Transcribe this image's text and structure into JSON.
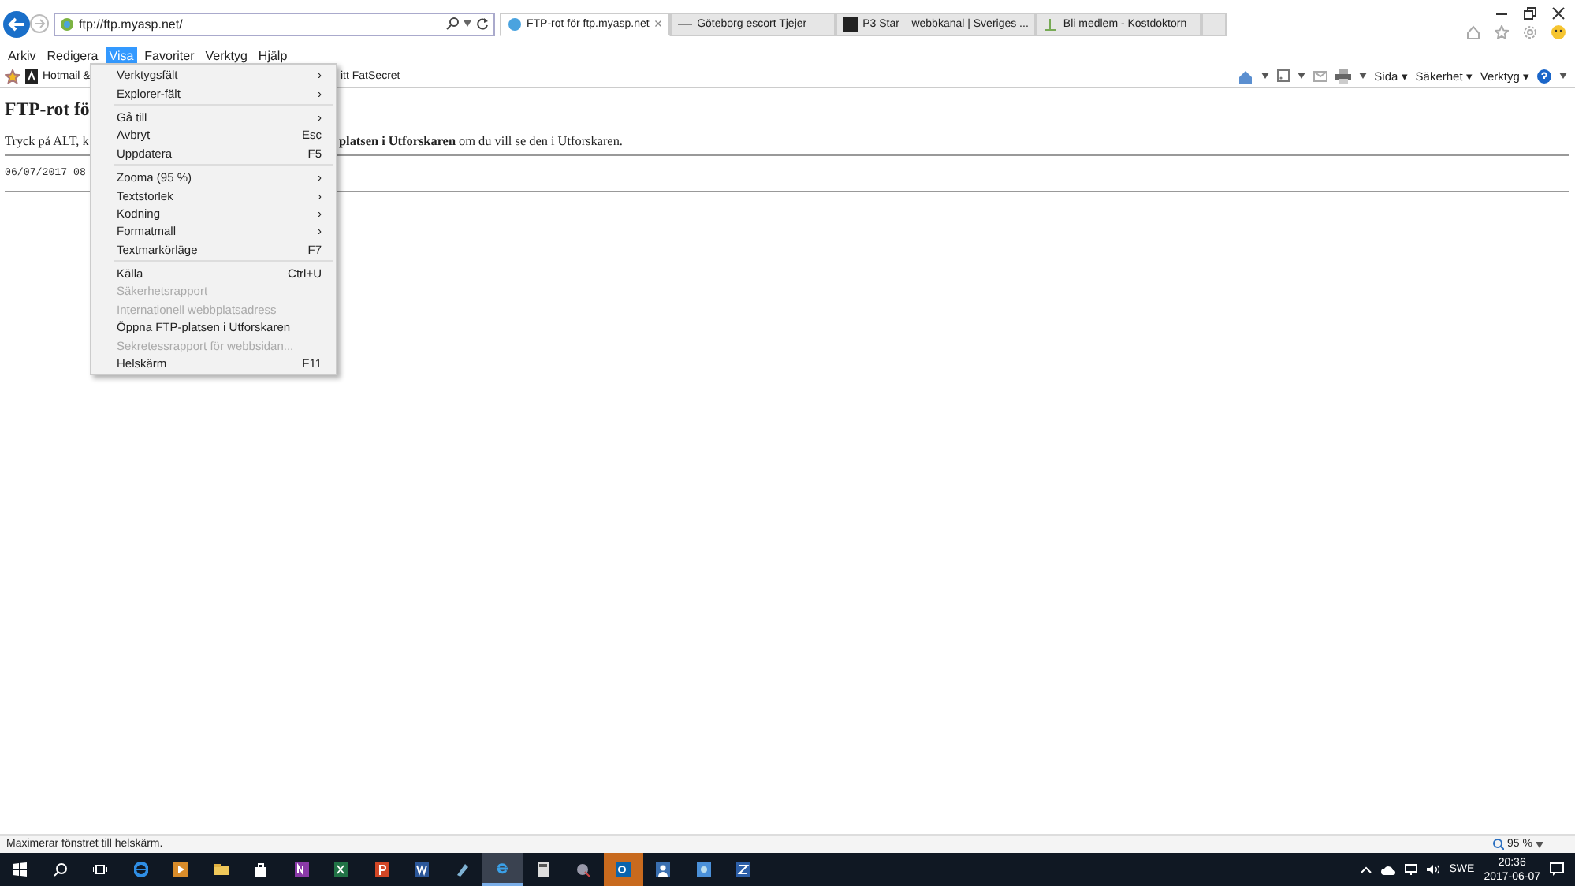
{
  "browser": {
    "address": "ftp://ftp.myasp.net/",
    "tabs": [
      {
        "label": "FTP-rot för ftp.myasp.net",
        "selected": true
      },
      {
        "label": "Göteborg escort Tjejer",
        "selected": false
      },
      {
        "label": "P3 Star – webbkanal | Sveriges ...",
        "selected": false
      },
      {
        "label": "Bli medlem - Kostdoktorn",
        "selected": false
      }
    ],
    "close_tab": "×"
  },
  "menu_bar": [
    {
      "label": "Arkiv",
      "selected": false
    },
    {
      "label": "Redigera",
      "selected": false
    },
    {
      "label": "Visa",
      "selected": true
    },
    {
      "label": "Favoriter",
      "selected": false
    },
    {
      "label": "Verktyg",
      "selected": false
    },
    {
      "label": "Hjälp",
      "selected": false
    }
  ],
  "favorites_bar": [
    "Hotmail &",
    "itt FatSecret"
  ],
  "command_bar": [
    "Sida ▾",
    "Säkerhet ▾",
    "Verktyg ▾"
  ],
  "view_menu": [
    {
      "kind": "item",
      "label": "Verktygsfält",
      "shortcut": "›",
      "disabled": false
    },
    {
      "kind": "item",
      "label": "Explorer-fält",
      "shortcut": "›",
      "disabled": false
    },
    {
      "kind": "separator"
    },
    {
      "kind": "item",
      "label": "Gå till",
      "shortcut": "›",
      "disabled": false
    },
    {
      "kind": "item",
      "label": "Avbryt",
      "shortcut": "Esc",
      "disabled": false
    },
    {
      "kind": "item",
      "label": "Uppdatera",
      "shortcut": "F5",
      "disabled": false
    },
    {
      "kind": "separator"
    },
    {
      "kind": "item",
      "label": "Zooma (95 %)",
      "shortcut": "›",
      "disabled": false
    },
    {
      "kind": "item",
      "label": "Textstorlek",
      "shortcut": "›",
      "disabled": false
    },
    {
      "kind": "item",
      "label": "Kodning",
      "shortcut": "›",
      "disabled": false
    },
    {
      "kind": "item",
      "label": "Formatmall",
      "shortcut": "›",
      "disabled": false
    },
    {
      "kind": "item",
      "label": "Textmarkörläge",
      "shortcut": "F7",
      "disabled": false
    },
    {
      "kind": "separator"
    },
    {
      "kind": "item",
      "label": "Källa",
      "shortcut": "Ctrl+U",
      "disabled": false
    },
    {
      "kind": "item",
      "label": "Säkerhetsrapport",
      "disabled": true
    },
    {
      "kind": "item",
      "label": "Internationell webbplatsadress",
      "disabled": true
    },
    {
      "kind": "item",
      "label": "Öppna FTP-platsen i Utforskaren",
      "disabled": false
    },
    {
      "kind": "item",
      "label": "Sekretessrapport för webbsidan...",
      "disabled": true
    },
    {
      "kind": "item",
      "label": "Helskärm",
      "shortcut": "F11",
      "disabled": false
    }
  ],
  "page": {
    "heading": "FTP-rot fö",
    "text_start": "Tryck på ALT, k",
    "text_end": "**platsen i Utforskaren** om du vill se den i Utforskaren.",
    "listing": "06/07/2017 08"
  },
  "status_bar": {
    "message": "Maximerar fönstret till helskärm.",
    "zoom": "95 %"
  },
  "taskbar": {
    "language": "SWE",
    "time": "20:36",
    "date": "2017-06-07"
  }
}
